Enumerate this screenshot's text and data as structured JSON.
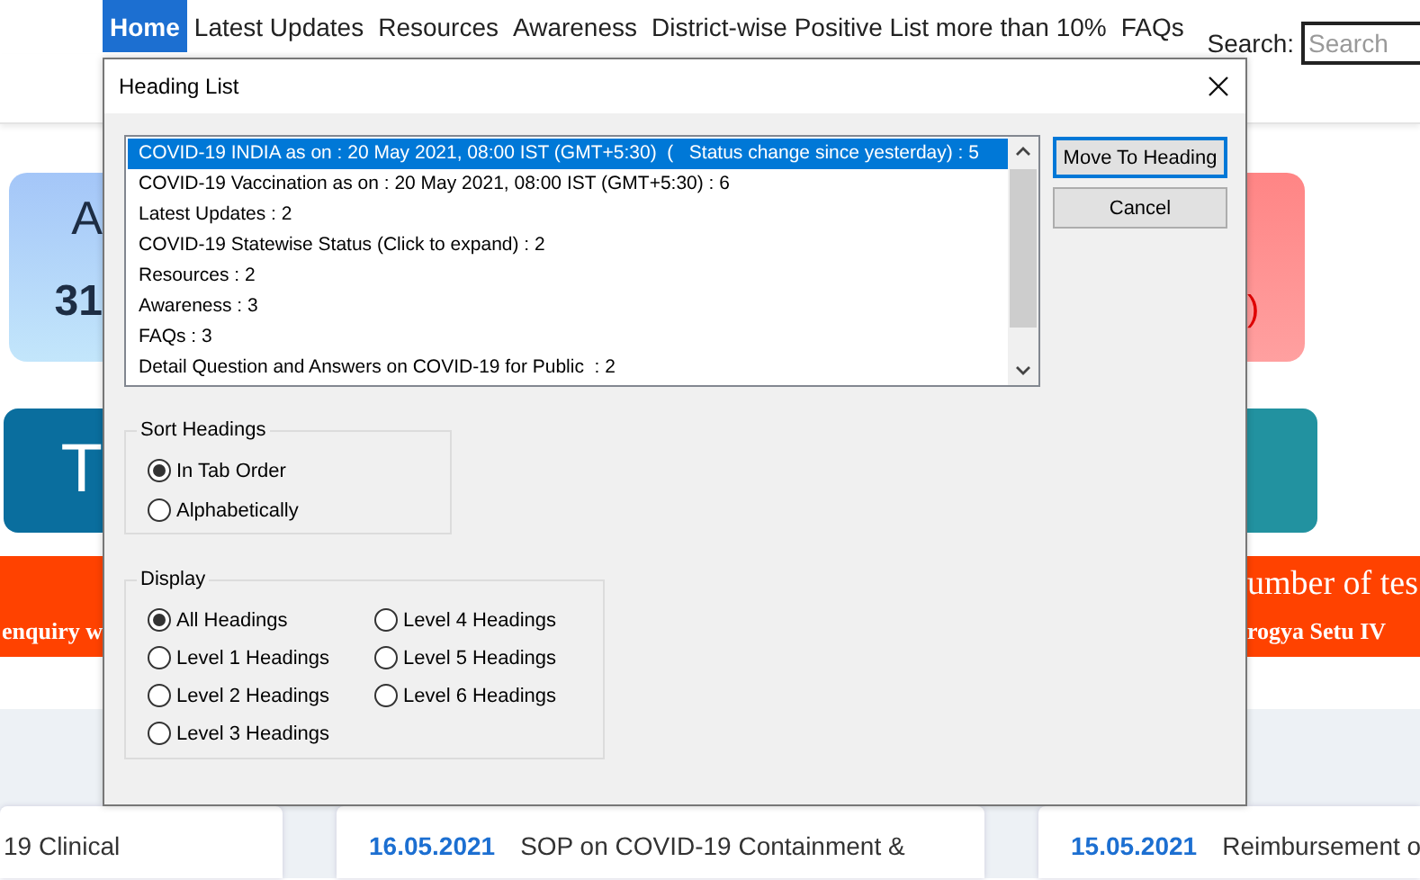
{
  "nav": {
    "items": [
      {
        "label": "Home",
        "selected": true
      },
      {
        "label": "Latest Updates",
        "selected": false
      },
      {
        "label": "Resources",
        "selected": false
      },
      {
        "label": "Awareness",
        "selected": false
      },
      {
        "label": "District-wise Positive List more than 10%",
        "selected": false
      },
      {
        "label": "FAQs",
        "selected": false
      }
    ],
    "search": {
      "label": "Search:",
      "placeholder": "Search"
    }
  },
  "background": {
    "stat_card_left": {
      "title": "A",
      "value": "31"
    },
    "stat_card_right": {
      "value": ")"
    },
    "tile_left": {
      "label": "T"
    },
    "ticker": {
      "left_line_2": "enquiry w",
      "right_line_1": "umber of tes",
      "right_line_2": "rogya Setu IV"
    },
    "news": [
      {
        "title": "19 Clinical"
      },
      {
        "date": "16.05.2021",
        "title": "SOP on COVID-19 Containment &"
      },
      {
        "date": "15.05.2021",
        "title": "Reimbursement o"
      }
    ]
  },
  "dialog": {
    "title": "Heading List",
    "list": [
      {
        "label": "COVID-19 INDIA as on : 20 May 2021, 08:00 IST (GMT+5:30)  (   Status change since yesterday) : 5",
        "selected": true
      },
      {
        "label": "COVID-19 Vaccination as on : 20 May 2021, 08:00 IST (GMT+5:30) : 6",
        "selected": false
      },
      {
        "label": "Latest Updates : 2",
        "selected": false
      },
      {
        "label": "COVID-19 Statewise Status (Click to expand) : 2",
        "selected": false
      },
      {
        "label": "Resources : 2",
        "selected": false
      },
      {
        "label": "Awareness : 3",
        "selected": false
      },
      {
        "label": "FAQs : 3",
        "selected": false
      },
      {
        "label": "Detail Question and Answers on COVID-19 for Public  : 2",
        "selected": false
      }
    ],
    "buttons": [
      {
        "label": "Move To Heading",
        "kind": "default"
      },
      {
        "label": "Cancel",
        "kind": "normal"
      }
    ],
    "sort_headings": {
      "label": "Sort Headings",
      "options": [
        {
          "label": "In Tab Order",
          "selected": true
        },
        {
          "label": "Alphabetically",
          "selected": false
        }
      ]
    },
    "display": {
      "label": "Display",
      "options": [
        {
          "label": "All Headings",
          "selected": true
        },
        {
          "label": "Level 1 Headings",
          "selected": false
        },
        {
          "label": "Level 2 Headings",
          "selected": false
        },
        {
          "label": "Level 3 Headings",
          "selected": false
        },
        {
          "label": "Level 4 Headings",
          "selected": false
        },
        {
          "label": "Level 5 Headings",
          "selected": false
        },
        {
          "label": "Level 6 Headings",
          "selected": false
        }
      ]
    }
  }
}
